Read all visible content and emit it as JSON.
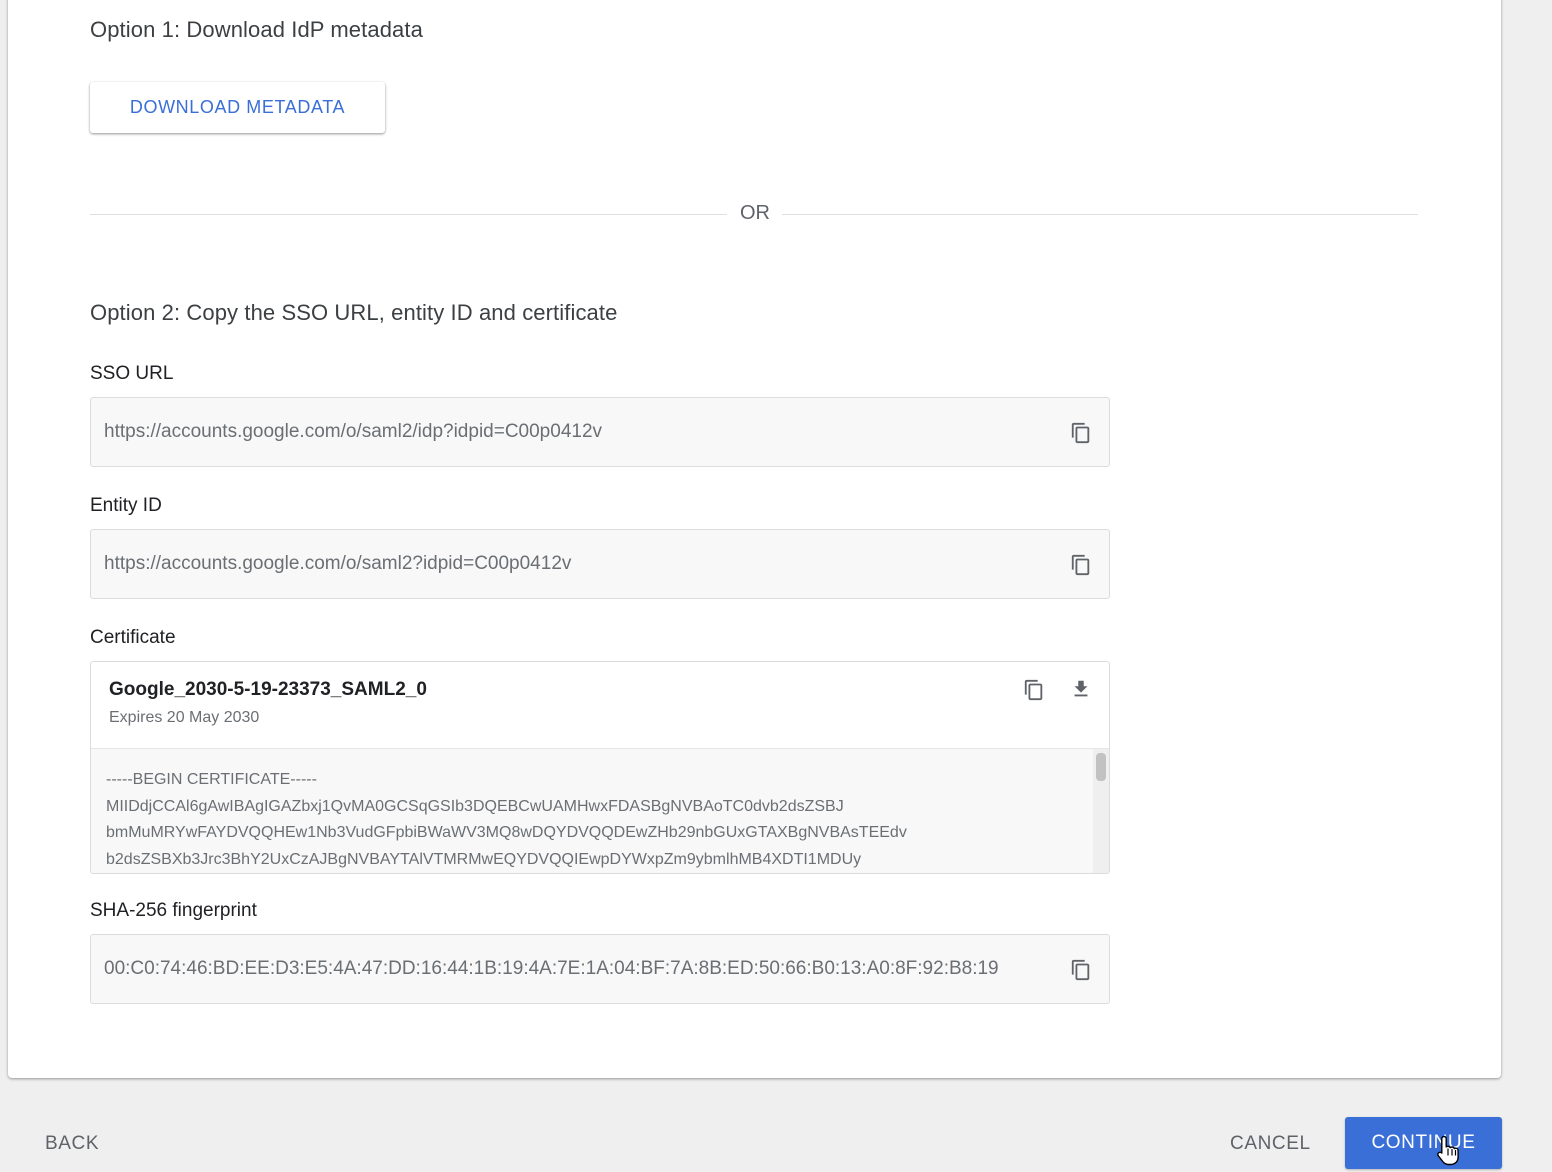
{
  "option1": {
    "heading": "Option 1: Download IdP metadata",
    "download_label": "DOWNLOAD METADATA"
  },
  "divider": {
    "label": "OR"
  },
  "option2": {
    "heading": "Option 2: Copy the SSO URL, entity ID and certificate",
    "sso_url": {
      "label": "SSO URL",
      "value": "https://accounts.google.com/o/saml2/idp?idpid=C00p0412v"
    },
    "entity_id": {
      "label": "Entity ID",
      "value": "https://accounts.google.com/o/saml2?idpid=C00p0412v"
    },
    "certificate": {
      "label": "Certificate",
      "name": "Google_2030-5-19-23373_SAML2_0",
      "expires": "Expires 20 May 2030",
      "lines": [
        "-----BEGIN CERTIFICATE-----",
        "MIIDdjCCAl6gAwIBAgIGAZbxj1QvMA0GCSqGSIb3DQEBCwUAMHwxFDASBgNVBAoTC0dvb2dsZSBJ",
        "bmMuMRYwFAYDVQQHEw1Nb3VudGFpbiBWaWV3MQ8wDQYDVQQDEwZHb29nbGUxGTAXBgNVBAsTEEdv",
        "b2dsZSBXb3Jrc3BhY2UxCzAJBgNVBAYTAlVTMRMwEQYDVQQIEwpDYWxpZm9ybmlhMB4XDTI1MDUy"
      ]
    },
    "fingerprint": {
      "label": "SHA-256 fingerprint",
      "value": "00:C0:74:46:BD:EE:D3:E5:4A:47:DD:16:44:1B:19:4A:7E:1A:04:BF:7A:8B:ED:50:66:B0:13:A0:8F:92:B8:19"
    }
  },
  "footer": {
    "back_label": "BACK",
    "cancel_label": "CANCEL",
    "continue_label": "CONTINUE"
  },
  "colors": {
    "accent": "#3a6fd8",
    "page_background": "#efefef",
    "field_background": "#f8f8f8"
  },
  "icons": {
    "copy": "copy-icon",
    "download": "download-icon",
    "cursor": "hand-pointer-cursor"
  }
}
